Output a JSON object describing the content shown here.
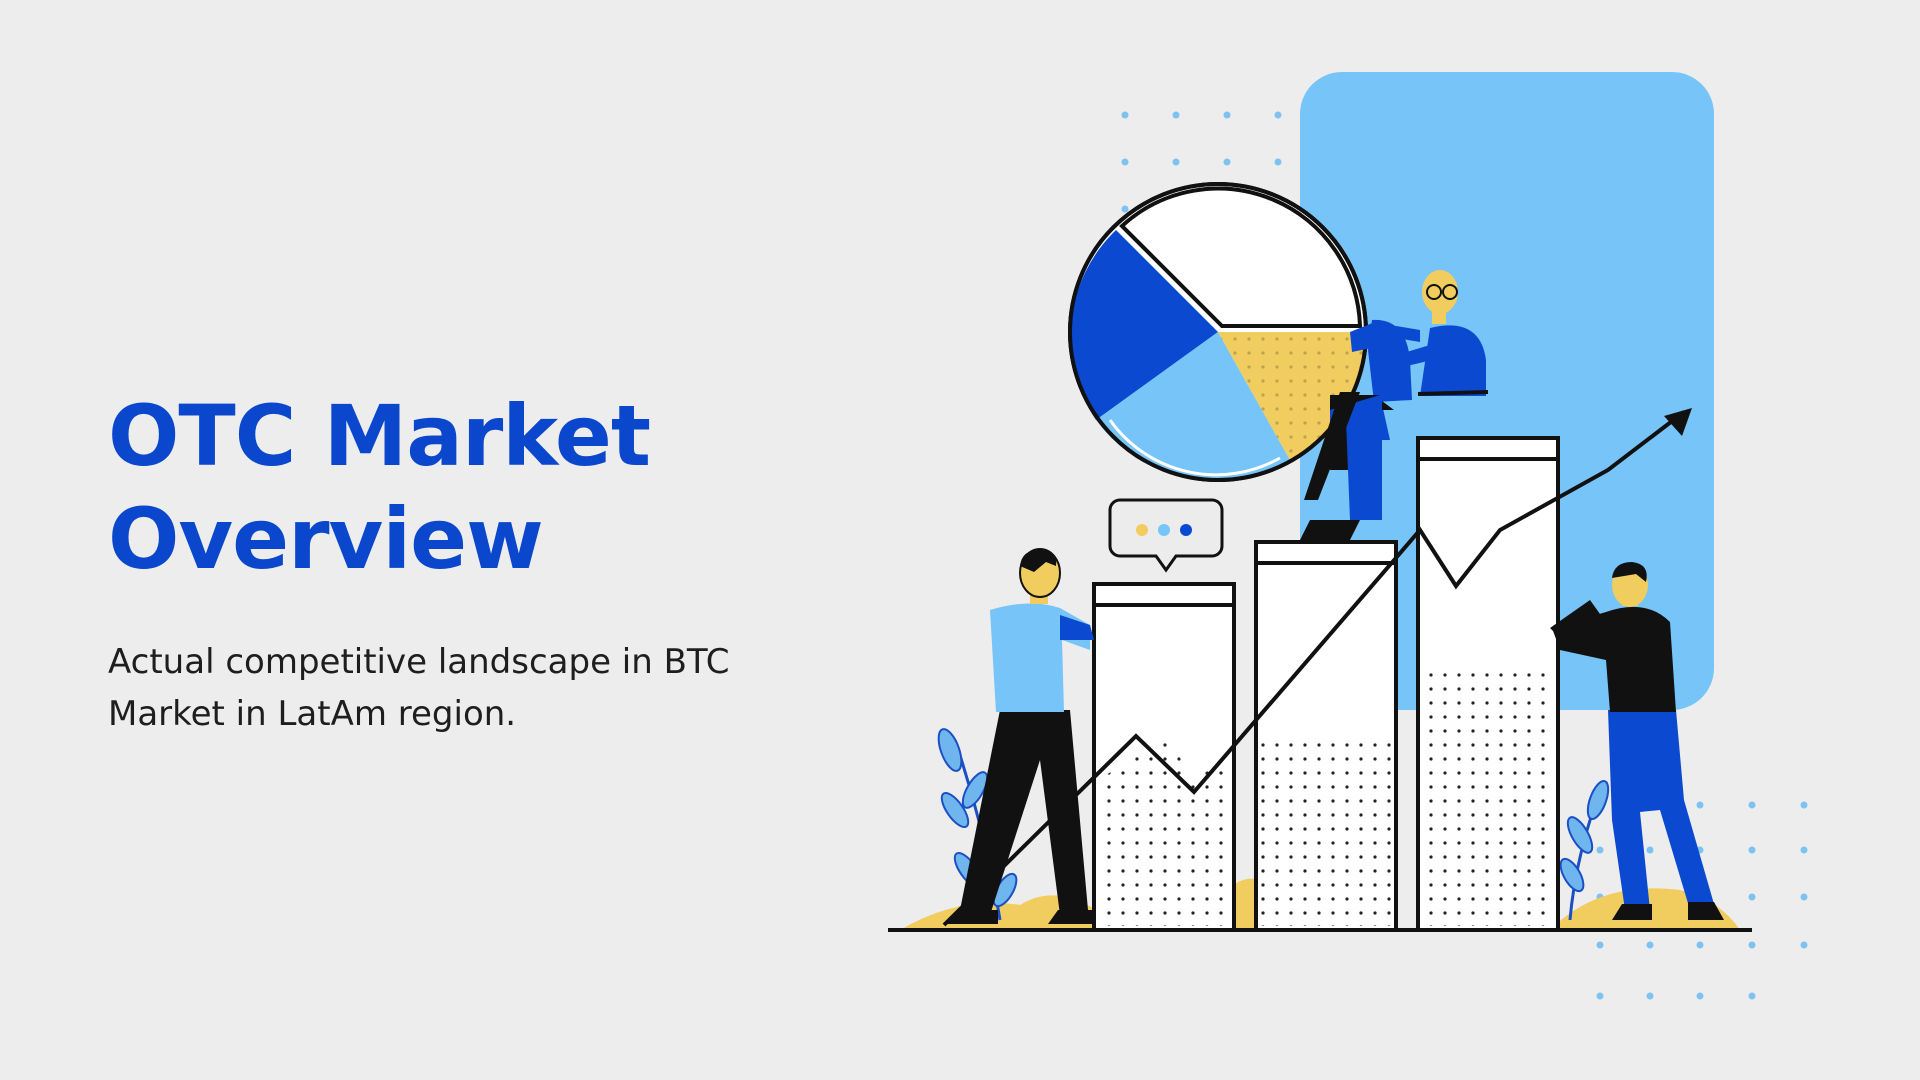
{
  "slide": {
    "title_line1": "OTC Market",
    "title_line2": "Overview",
    "subtitle": "Actual competitive landscape in BTC Market in LatAm region."
  },
  "illustration": {
    "description_name": "business-analytics-illustration"
  },
  "colors": {
    "background": "#ededed",
    "title": "#0a47cc",
    "text": "#1e1e1e",
    "accent_light_blue": "#76c4f8",
    "accent_blue": "#0b4ad0",
    "accent_yellow": "#f0cd5e"
  }
}
